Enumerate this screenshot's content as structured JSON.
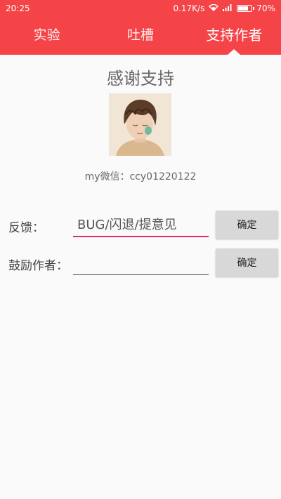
{
  "status_bar": {
    "time": "20:25",
    "speed": "0.17K/s",
    "battery": "70%",
    "icons": [
      "wifi-icon",
      "signal-icon",
      "battery-icon"
    ]
  },
  "tabs": [
    {
      "label": "实验",
      "active": false
    },
    {
      "label": "吐槽",
      "active": false
    },
    {
      "label": "支持作者",
      "active": true
    }
  ],
  "colors": {
    "appbar": "#f44448",
    "focus_underline": "#e0305f",
    "button": "#d8d8d8"
  },
  "main": {
    "title": "感谢支持",
    "wechat": "my微信：ccy01220122"
  },
  "feedback": {
    "label": "反馈：",
    "placeholder": "BUG/闪退/提意见",
    "value": "",
    "button": "确定"
  },
  "encourage": {
    "label": "鼓励作者：",
    "placeholder": "",
    "value": "",
    "button": "确定"
  }
}
